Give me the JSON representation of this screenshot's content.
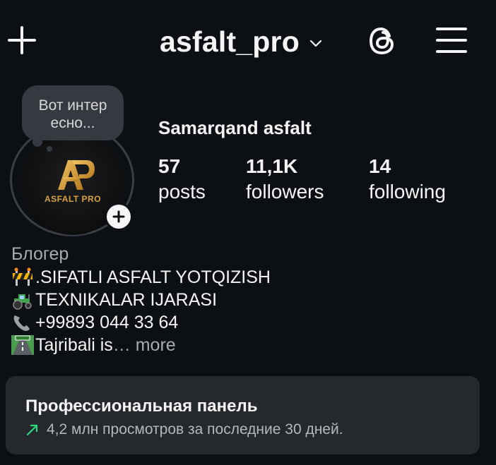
{
  "header": {
    "username": "asfalt_pro",
    "icons": [
      "plus-icon",
      "chevron-down-icon",
      "threads-icon",
      "menu-icon"
    ]
  },
  "note": {
    "text": "Вот интер есно..."
  },
  "avatar": {
    "brand_text": "ASFALT PRO",
    "logo_letters": "AP"
  },
  "profile": {
    "name": "Samarqand asfalt",
    "stats": [
      {
        "value": "57",
        "label": "posts"
      },
      {
        "value": "11,1K",
        "label": "followers"
      },
      {
        "value": "14",
        "label": "following"
      }
    ]
  },
  "bio": {
    "category": "Блогер",
    "lines": [
      {
        "emoji": "construction-barrier",
        "text": ".SIFATLI ASFALT YOTQIZISH"
      },
      {
        "emoji": "tractor",
        "text": " TEXNIKALAR IJARASI"
      },
      {
        "emoji": "telephone",
        "text": "+99893 044 33 64"
      },
      {
        "emoji": "motorway",
        "text": "Tajribali is",
        "more": "… more"
      }
    ]
  },
  "dashboard": {
    "title": "Профессиональная панель",
    "subtitle": "4,2 млн просмотров за последние 30 дней."
  },
  "colors": {
    "background": "#0c1014",
    "card": "#25292e",
    "note_bubble": "#363a40",
    "trend_green": "#2fd67c",
    "brand_gold": "#d9a13a"
  }
}
